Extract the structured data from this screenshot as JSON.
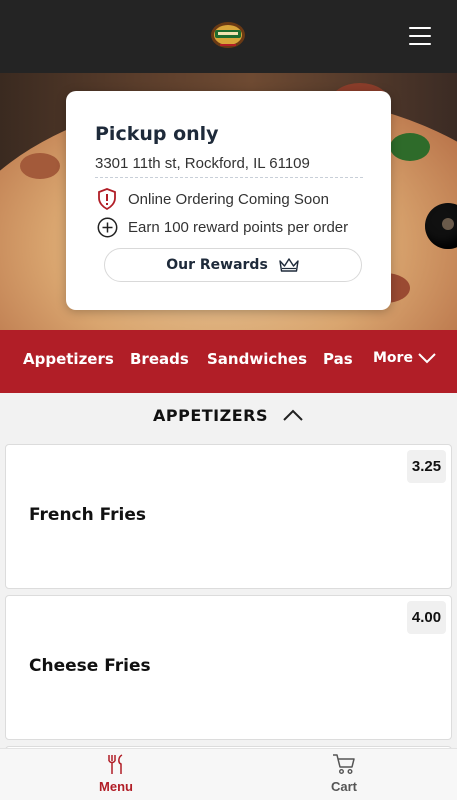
{
  "header": {
    "logo_icon": "restaurant-logo",
    "menu_icon": "hamburger-icon"
  },
  "store_card": {
    "title": "Pickup only",
    "address": "3301 11th st, Rockford, IL 61109",
    "notice": "Online Ordering Coming Soon",
    "notice_icon": "shield-alert-icon",
    "rewards_info": "Earn 100 reward points per order",
    "rewards_info_icon": "plus-circle-icon",
    "rewards_button": "Our Rewards",
    "rewards_button_icon": "crown-icon"
  },
  "categories": {
    "items": [
      "Appetizers",
      "Breads",
      "Sandwiches",
      "Pas"
    ],
    "more_label": "More",
    "more_icon": "chevron-down-icon"
  },
  "section": {
    "title": "APPETIZERS",
    "toggle_icon": "chevron-up-icon"
  },
  "menu_items": [
    {
      "name": "French Fries",
      "price": "3.25"
    },
    {
      "name": "Cheese Fries",
      "price": "4.00"
    }
  ],
  "bottom_nav": {
    "menu_label": "Menu",
    "menu_icon": "fork-knife-icon",
    "cart_label": "Cart",
    "cart_icon": "cart-icon"
  },
  "colors": {
    "brand_red": "#b11e27",
    "header_dark": "#242424",
    "title_navy": "#1e2a3a"
  }
}
